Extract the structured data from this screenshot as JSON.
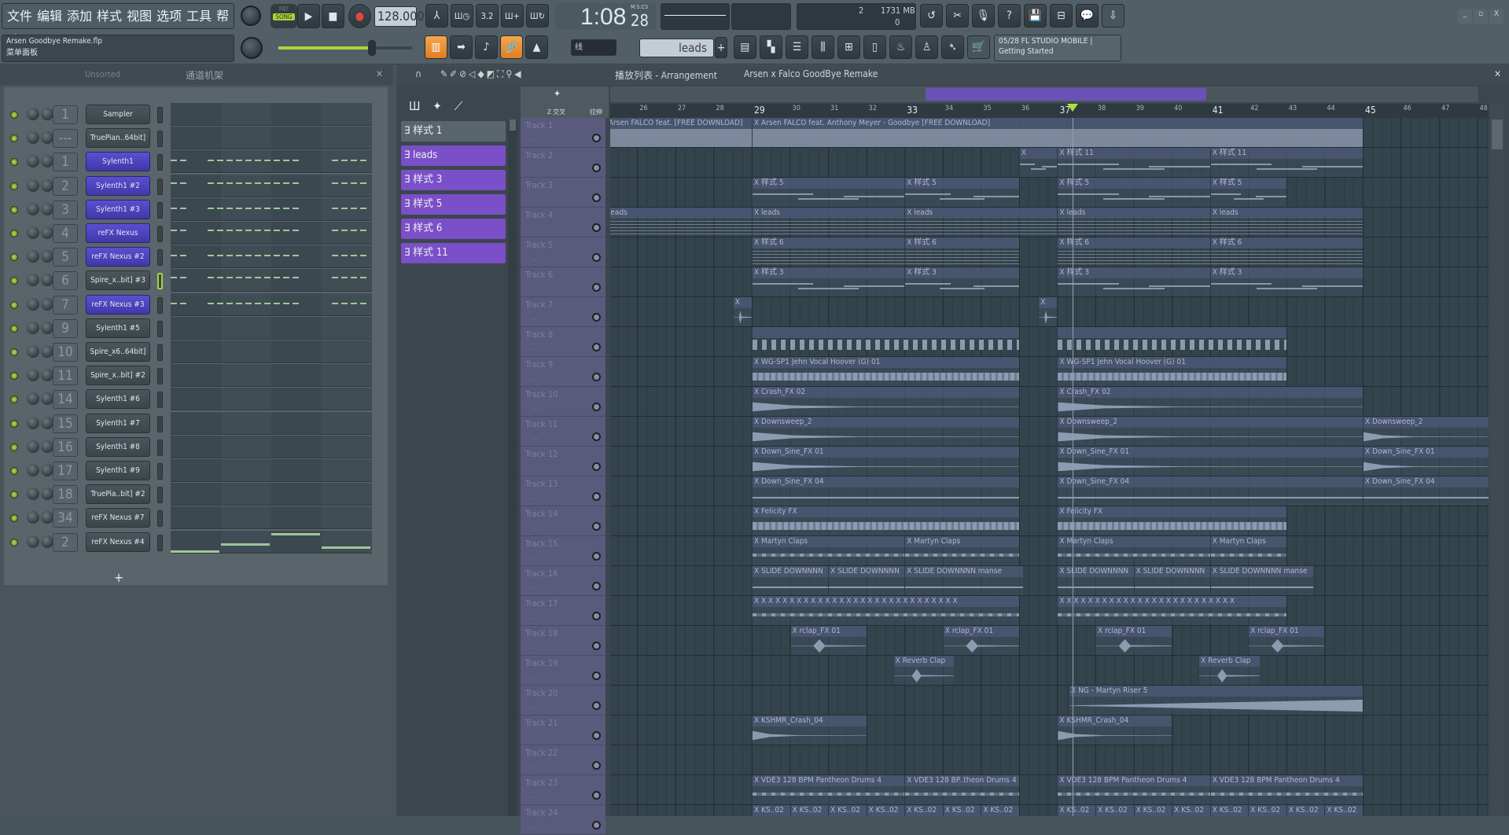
{
  "menu": [
    "文件",
    "编辑",
    "添加",
    "样式",
    "视图",
    "选项",
    "工具",
    "帮助"
  ],
  "transport": {
    "pat": "PAT",
    "song": "SONG",
    "tempo": "128.000",
    "time": "1:08",
    "time_cs": "28",
    "time_unit": "M:S:CS"
  },
  "monitor": {
    "cpu": "2",
    "memory": "1731 MB",
    "poly": "0"
  },
  "file": {
    "name": "Arsen Goodbye Remake.flp",
    "hint": "菜单面板"
  },
  "snap": "线",
  "pattern_selector": "leads",
  "news": {
    "line1": "05/28  FL STUDIO MOBILE |",
    "line2": "Getting Started"
  },
  "channel_rack": {
    "filter": "Unsorted",
    "title": "通道机架",
    "add": "+",
    "channels": [
      {
        "num": "1",
        "name": "Sampler",
        "selected": false
      },
      {
        "num": "---",
        "name": "TruePian..64bit]",
        "selected": false
      },
      {
        "num": "1",
        "name": "Sylenth1",
        "selected": true
      },
      {
        "num": "2",
        "name": "Sylenth1 #2",
        "selected": true
      },
      {
        "num": "3",
        "name": "Sylenth1 #3",
        "selected": true
      },
      {
        "num": "4",
        "name": "reFX Nexus",
        "selected": true
      },
      {
        "num": "5",
        "name": "reFX Nexus #2",
        "selected": true
      },
      {
        "num": "6",
        "name": "Spire_x..bit] #3",
        "selected": false,
        "active": true
      },
      {
        "num": "7",
        "name": "reFX Nexus #3",
        "selected": true
      },
      {
        "num": "9",
        "name": "Sylenth1 #5",
        "selected": false
      },
      {
        "num": "10",
        "name": "Spire_x6..64bit]",
        "selected": false
      },
      {
        "num": "11",
        "name": "Spire_x..bit] #2",
        "selected": false
      },
      {
        "num": "14",
        "name": "Sylenth1 #6",
        "selected": false
      },
      {
        "num": "15",
        "name": "Sylenth1 #7",
        "selected": false
      },
      {
        "num": "16",
        "name": "Sylenth1 #8",
        "selected": false
      },
      {
        "num": "17",
        "name": "Sylenth1 #9",
        "selected": false
      },
      {
        "num": "18",
        "name": "TruePia..bit] #2",
        "selected": false
      },
      {
        "num": "34",
        "name": "reFX Nexus #7",
        "selected": false
      },
      {
        "num": "2",
        "name": "reFX Nexus #4",
        "selected": false
      }
    ]
  },
  "playlist": {
    "title": "播放列表 - Arrangement",
    "song": "Arsen x Falco GoodBye Remake",
    "opt1": "Z 交叉",
    "opt2": "拉伸",
    "patterns": [
      "样式 1",
      "leads",
      "样式 3",
      "样式 5",
      "样式 6",
      "样式 11"
    ],
    "ruler": [
      26,
      27,
      28,
      29,
      30,
      31,
      32,
      33,
      34,
      35,
      36,
      37,
      38,
      39,
      40,
      41,
      42,
      43,
      44,
      45,
      46,
      47,
      48
    ],
    "playhead_bar": 37.4,
    "tracks": [
      {
        "name": "Track 1",
        "clips": [
          {
            "s": 25,
            "e": 29,
            "label": "Arsen  FALCO feat. [FREE DOWNLOAD]",
            "k": "full"
          },
          {
            "s": 29,
            "e": 45,
            "label": "Arsen  FALCO feat. Anthony Meyer - Goodbye [FREE DOWNLOAD]",
            "k": "full"
          }
        ]
      },
      {
        "name": "Track 2",
        "clips": [
          {
            "s": 36,
            "e": 37,
            "label": "",
            "k": "pat"
          },
          {
            "s": 37,
            "e": 41,
            "label": "样式 11",
            "k": "pat"
          },
          {
            "s": 41,
            "e": 45,
            "label": "样式 11",
            "k": "pat"
          }
        ]
      },
      {
        "name": "Track 3",
        "clips": [
          {
            "s": 29,
            "e": 33,
            "label": "样式 5",
            "k": "pat"
          },
          {
            "s": 33,
            "e": 36,
            "label": "样式 5",
            "k": "pat"
          },
          {
            "s": 37,
            "e": 41,
            "label": "样式 5",
            "k": "pat"
          },
          {
            "s": 41,
            "e": 43,
            "label": "样式 5",
            "k": "pat"
          }
        ]
      },
      {
        "name": "Track 4",
        "clips": [
          {
            "s": 25,
            "e": 29,
            "label": "leads",
            "k": "dense"
          },
          {
            "s": 29,
            "e": 33,
            "label": "leads",
            "k": "dense"
          },
          {
            "s": 33,
            "e": 37,
            "label": "leads",
            "k": "dense"
          },
          {
            "s": 37,
            "e": 41,
            "label": "leads",
            "k": "dense"
          },
          {
            "s": 41,
            "e": 45,
            "label": "leads",
            "k": "dense"
          }
        ]
      },
      {
        "name": "Track 5",
        "clips": [
          {
            "s": 29,
            "e": 33,
            "label": "样式 6",
            "k": "dense"
          },
          {
            "s": 33,
            "e": 36,
            "label": "样式 6",
            "k": "dense"
          },
          {
            "s": 37,
            "e": 41,
            "label": "样式 6",
            "k": "dense"
          },
          {
            "s": 41,
            "e": 45,
            "label": "样式 6",
            "k": "dense"
          }
        ]
      },
      {
        "name": "Track 6",
        "clips": [
          {
            "s": 29,
            "e": 33,
            "label": "样式 3",
            "k": "pat"
          },
          {
            "s": 33,
            "e": 36,
            "label": "样式 3",
            "k": "pat"
          },
          {
            "s": 37,
            "e": 41,
            "label": "样式 3",
            "k": "pat"
          },
          {
            "s": 41,
            "e": 45,
            "label": "样式 3",
            "k": "pat"
          }
        ]
      },
      {
        "name": "Track 7",
        "clips": [
          {
            "s": 28.5,
            "e": 29,
            "label": "",
            "k": "hit"
          },
          {
            "s": 36.5,
            "e": 37,
            "label": "",
            "k": "hit"
          }
        ]
      },
      {
        "name": "Track 8",
        "clips": [
          {
            "s": 29,
            "e": 36,
            "label": "",
            "k": "arrows"
          },
          {
            "s": 37,
            "e": 43,
            "label": "",
            "k": "arrows"
          }
        ]
      },
      {
        "name": "Track 9",
        "clips": [
          {
            "s": 29,
            "e": 36,
            "label": "WG-SP1 Jehn Vocal Hoover (G) 01",
            "k": "loop"
          },
          {
            "s": 37,
            "e": 43,
            "label": "WG-SP1 Jehn Vocal Hoover (G) 01",
            "k": "loop"
          }
        ]
      },
      {
        "name": "Track 10",
        "clips": [
          {
            "s": 29,
            "e": 36,
            "label": "Crash_FX 02",
            "k": "decay"
          },
          {
            "s": 37,
            "e": 45,
            "label": "Crash_FX 02",
            "k": "decay"
          }
        ]
      },
      {
        "name": "Track 11",
        "clips": [
          {
            "s": 29,
            "e": 36,
            "label": "Downsweep_2",
            "k": "decay"
          },
          {
            "s": 37,
            "e": 45,
            "label": "Downsweep_2",
            "k": "decay"
          },
          {
            "s": 45,
            "e": 48.4,
            "label": "Downsweep_2",
            "k": "decay"
          }
        ]
      },
      {
        "name": "Track 12",
        "clips": [
          {
            "s": 29,
            "e": 36,
            "label": "Down_Sine_FX 01",
            "k": "decay"
          },
          {
            "s": 37,
            "e": 45,
            "label": "Down_Sine_FX 01",
            "k": "decay"
          },
          {
            "s": 45,
            "e": 48.4,
            "label": "Down_Sine_FX 01",
            "k": "decay"
          }
        ]
      },
      {
        "name": "Track 13",
        "clips": [
          {
            "s": 29,
            "e": 36,
            "label": "Down_Sine_FX 04",
            "k": "flat"
          },
          {
            "s": 37,
            "e": 45,
            "label": "Down_Sine_FX 04",
            "k": "flat"
          },
          {
            "s": 45,
            "e": 48.4,
            "label": "Down_Sine_FX 04",
            "k": "flat"
          }
        ]
      },
      {
        "name": "Track 14",
        "clips": [
          {
            "s": 29,
            "e": 36,
            "label": "Felicity FX",
            "k": "loop"
          },
          {
            "s": 37,
            "e": 43,
            "label": "Felicity FX",
            "k": "loop"
          }
        ]
      },
      {
        "name": "Track 15",
        "clips": [
          {
            "s": 29,
            "e": 33,
            "label": "Martyn Claps",
            "k": "beads"
          },
          {
            "s": 33,
            "e": 36,
            "label": "Martyn Claps",
            "k": "beads"
          },
          {
            "s": 37,
            "e": 41,
            "label": "Martyn Claps",
            "k": "beads"
          },
          {
            "s": 41,
            "e": 43,
            "label": "Martyn Claps",
            "k": "beads"
          }
        ]
      },
      {
        "name": "Track 16",
        "clips": [
          {
            "s": 29,
            "e": 31,
            "label": "SLIDE DOWNNNN",
            "k": "flat"
          },
          {
            "s": 31,
            "e": 33,
            "label": "SLIDE DOWNNNN",
            "k": "flat"
          },
          {
            "s": 33,
            "e": 36.1,
            "label": "SLIDE DOWNNNN manse",
            "k": "flat"
          },
          {
            "s": 37,
            "e": 39,
            "label": "SLIDE DOWNNNN",
            "k": "flat"
          },
          {
            "s": 39,
            "e": 41,
            "label": "SLIDE DOWNNNN",
            "k": "flat"
          },
          {
            "s": 41,
            "e": 43.7,
            "label": "SLIDE DOWNNNN manse",
            "k": "flat"
          }
        ]
      },
      {
        "name": "Track 17",
        "clips": [
          {
            "s": 29,
            "e": 36,
            "label": "X X X X X X X X X X X X X X X X X X X X X X X X X X X X",
            "k": "beads"
          },
          {
            "s": 37,
            "e": 43,
            "label": "X X X X X X X X X X X X X X X X X X X X X X X X",
            "k": "beads"
          }
        ]
      },
      {
        "name": "Track 18",
        "clips": [
          {
            "s": 30,
            "e": 32,
            "label": "rclap_FX 01",
            "k": "hit"
          },
          {
            "s": 34,
            "e": 36,
            "label": "rclap_FX 01",
            "k": "hit"
          },
          {
            "s": 38,
            "e": 40,
            "label": "rclap_FX 01",
            "k": "hit"
          },
          {
            "s": 42,
            "e": 44,
            "label": "rclap_FX 01",
            "k": "hit"
          }
        ]
      },
      {
        "name": "Track 19",
        "clips": [
          {
            "s": 32.7,
            "e": 34.3,
            "label": "Reverb Clap",
            "k": "hit"
          },
          {
            "s": 40.7,
            "e": 42.3,
            "label": "Reverb Clap",
            "k": "hit"
          }
        ]
      },
      {
        "name": "Track 20",
        "clips": [
          {
            "s": 37.3,
            "e": 45,
            "label": "NG - Martyn Riser 5",
            "k": "rise"
          }
        ]
      },
      {
        "name": "Track 21",
        "clips": [
          {
            "s": 29,
            "e": 32,
            "label": "KSHMR_Crash_04",
            "k": "decay"
          },
          {
            "s": 37,
            "e": 40,
            "label": "KSHMR_Crash_04",
            "k": "decay"
          }
        ]
      },
      {
        "name": "Track 22",
        "clips": []
      },
      {
        "name": "Track 23",
        "clips": [
          {
            "s": 29,
            "e": 33,
            "label": "VDE3 128 BPM Pantheon Drums 4",
            "k": "beads"
          },
          {
            "s": 33,
            "e": 36,
            "label": "VDE3 128 BP..theon Drums 4",
            "k": "beads"
          },
          {
            "s": 37,
            "e": 41,
            "label": "VDE3 128 BPM Pantheon Drums 4",
            "k": "beads"
          },
          {
            "s": 41,
            "e": 45,
            "label": "VDE3 128 BPM Pantheon Drums 4",
            "k": "beads"
          }
        ]
      },
      {
        "name": "Track 24",
        "clips": [
          {
            "s": 29,
            "e": 30,
            "label": "KS..02",
            "k": "beads"
          },
          {
            "s": 30,
            "e": 31,
            "label": "KS..02",
            "k": "beads"
          },
          {
            "s": 31,
            "e": 32,
            "label": "KS..02",
            "k": "beads"
          },
          {
            "s": 32,
            "e": 33,
            "label": "KS..02",
            "k": "beads"
          },
          {
            "s": 33,
            "e": 34,
            "label": "KS..02",
            "k": "beads"
          },
          {
            "s": 34,
            "e": 35,
            "label": "KS..02",
            "k": "beads"
          },
          {
            "s": 35,
            "e": 36,
            "label": "KS..02",
            "k": "beads"
          },
          {
            "s": 37,
            "e": 38,
            "label": "KS..02",
            "k": "beads"
          },
          {
            "s": 38,
            "e": 39,
            "label": "KS..02",
            "k": "beads"
          },
          {
            "s": 39,
            "e": 40,
            "label": "KS..02",
            "k": "beads"
          },
          {
            "s": 40,
            "e": 41,
            "label": "KS..02",
            "k": "beads"
          },
          {
            "s": 41,
            "e": 42,
            "label": "KS..02",
            "k": "beads"
          },
          {
            "s": 42,
            "e": 43,
            "label": "KS..02",
            "k": "beads"
          },
          {
            "s": 43,
            "e": 44,
            "label": "KS..02",
            "k": "beads"
          },
          {
            "s": 44,
            "e": 45,
            "label": "KS..02",
            "k": "beads"
          }
        ]
      }
    ]
  },
  "colors": {
    "accent_orange": "#f0922e",
    "channel_selected": "#4f44c4",
    "pattern_purple": "#7a4fc7",
    "track_header": "#5a5a7c",
    "grid_bg": "#34444c",
    "led_green": "#a4d53b"
  }
}
